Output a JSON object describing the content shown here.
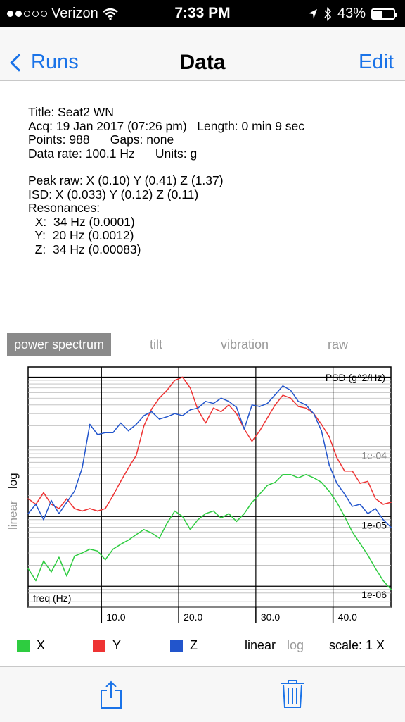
{
  "status": {
    "carrier": "Verizon",
    "time": "7:33 PM",
    "battery": "43%",
    "signal_bars": 2
  },
  "nav": {
    "back_label": "Runs",
    "title": "Data",
    "edit_label": "Edit"
  },
  "info": {
    "title": "Title: Seat2 WN",
    "acq": "Acq: 19 Jan 2017 (07:26 pm)   Length: 0 min 9 sec",
    "points": "Points: 988      Gaps: none",
    "rate": "Data rate: 100.1 Hz      Units: g",
    "peak": "Peak raw: X (0.10) Y (0.41) Z (1.37)",
    "isd": "ISD: X (0.033) Y (0.12) Z (0.11)",
    "res": "Resonances:",
    "rx": "  X:  34 Hz (0.0001)",
    "ry": "  Y:  20 Hz (0.0012)",
    "rz": "  Z:  34 Hz (0.00083)"
  },
  "tabs": [
    "power spectrum",
    "tilt",
    "vibration",
    "raw"
  ],
  "side_labels": {
    "linear": "linear",
    "log": "log"
  },
  "chart_data": {
    "type": "line",
    "title": "PSD (g^2/Hz)",
    "xlabel": "freq (Hz)",
    "x_ticks": [
      "10.0",
      "20.0",
      "30.0",
      "40.0"
    ],
    "y_ticks": [
      "1e-04",
      "1e-05",
      "1e-06"
    ],
    "yscale": "log",
    "ylim": [
      5e-07,
      0.0014
    ],
    "xlim": [
      0.5,
      47.5
    ],
    "grid": true,
    "series": [
      {
        "name": "X",
        "color": "#2ecc40",
        "x": [
          0.5,
          1.5,
          2.5,
          3.5,
          4.5,
          5.5,
          6.5,
          7.5,
          8.5,
          9.5,
          10.5,
          11.5,
          12.5,
          13.5,
          14.5,
          15.5,
          16.5,
          17.5,
          18.5,
          19.5,
          20.5,
          21.5,
          22.5,
          23.5,
          24.5,
          25.5,
          26.5,
          27.5,
          28.5,
          29.5,
          30.5,
          31.5,
          32.5,
          33.5,
          34.5,
          35.5,
          36.5,
          37.5,
          38.5,
          39.5,
          40.5,
          41.5,
          42.5,
          43.5,
          44.5,
          45.5,
          46.5,
          47.5
        ],
        "y": [
          1.8e-06,
          1.2e-06,
          2.3e-06,
          1.6e-06,
          2.6e-06,
          1.4e-06,
          2.7e-06,
          3e-06,
          3.4e-06,
          3.2e-06,
          2.4e-06,
          3.4e-06,
          4e-06,
          4.6e-06,
          5.5e-06,
          6.5e-06,
          5.8e-06,
          4.9e-06,
          8e-06,
          1.2e-05,
          1e-05,
          6.5e-06,
          9e-06,
          1.1e-05,
          1.2e-05,
          9.5e-06,
          1.1e-05,
          8.5e-06,
          1.1e-05,
          1.6e-05,
          2.1e-05,
          2.8e-05,
          3.1e-05,
          4e-05,
          4e-05,
          3.6e-05,
          4e-05,
          3.6e-05,
          3.1e-05,
          2.3e-05,
          1.6e-05,
          1e-05,
          6e-06,
          4.1e-06,
          2.8e-06,
          1.8e-06,
          1.2e-06,
          9e-07
        ]
      },
      {
        "name": "Y",
        "color": "#ee3333",
        "x": [
          0.5,
          1.5,
          2.5,
          3.5,
          4.5,
          5.5,
          6.5,
          7.5,
          8.5,
          9.5,
          10.5,
          11.5,
          12.5,
          13.5,
          14.5,
          15.5,
          16.5,
          17.5,
          18.5,
          19.5,
          20.5,
          21.5,
          22.5,
          23.5,
          24.5,
          25.5,
          26.5,
          27.5,
          28.5,
          29.5,
          30.5,
          31.5,
          32.5,
          33.5,
          34.5,
          35.5,
          36.5,
          37.5,
          38.5,
          39.5,
          40.5,
          41.5,
          42.5,
          43.5,
          44.5,
          45.5,
          46.5,
          47.5
        ],
        "y": [
          1.8e-05,
          1.5e-05,
          2.2e-05,
          1.5e-05,
          1.3e-05,
          1.8e-05,
          1.3e-05,
          1.2e-05,
          1.3e-05,
          1.2e-05,
          1.3e-05,
          2e-05,
          3.2e-05,
          5e-05,
          7.5e-05,
          0.0002,
          0.00035,
          0.0005,
          0.00065,
          0.0009,
          0.001,
          0.0007,
          0.00034,
          0.00022,
          0.00036,
          0.00032,
          0.0004,
          0.0003,
          0.00018,
          0.00012,
          0.00017,
          0.00026,
          0.0004,
          0.00055,
          0.0005,
          0.00038,
          0.00036,
          0.0003,
          0.00021,
          0.00014,
          7e-05,
          4.5e-05,
          4.5e-05,
          3e-05,
          3.2e-05,
          1.8e-05,
          1.5e-05,
          1.6e-05
        ]
      },
      {
        "name": "Z",
        "color": "#2255cc",
        "x": [
          0.5,
          1.5,
          2.5,
          3.5,
          4.5,
          5.5,
          6.5,
          7.5,
          8.5,
          9.5,
          10.5,
          11.5,
          12.5,
          13.5,
          14.5,
          15.5,
          16.5,
          17.5,
          18.5,
          19.5,
          20.5,
          21.5,
          22.5,
          23.5,
          24.5,
          25.5,
          26.5,
          27.5,
          28.5,
          29.5,
          30.5,
          31.5,
          32.5,
          33.5,
          34.5,
          35.5,
          36.5,
          37.5,
          38.5,
          39.5,
          40.5,
          41.5,
          42.5,
          43.5,
          44.5,
          45.5,
          46.5,
          47.5
        ],
        "y": [
          1.1e-05,
          1.5e-05,
          9e-06,
          1.7e-05,
          1.1e-05,
          1.6e-05,
          2.3e-05,
          5e-05,
          0.00021,
          0.00015,
          0.00016,
          0.00016,
          0.00022,
          0.00017,
          0.00021,
          0.00028,
          0.00032,
          0.00025,
          0.00027,
          0.0003,
          0.00028,
          0.00034,
          0.00036,
          0.00045,
          0.00042,
          0.0005,
          0.00045,
          0.00037,
          0.00018,
          0.0004,
          0.00038,
          0.00042,
          0.00056,
          0.00075,
          0.00065,
          0.00045,
          0.0004,
          0.0003,
          0.00017,
          5.5e-05,
          3e-05,
          2.1e-05,
          1.4e-05,
          1.5e-05,
          1.1e-05,
          1.3e-05,
          9e-06,
          7e-06
        ]
      }
    ]
  },
  "legend": {
    "x": "X",
    "y": "Y",
    "z": "Z",
    "x_color": "#2ecc40",
    "y_color": "#ee3333",
    "z_color": "#2255cc",
    "linear": "linear",
    "log": "log",
    "scale": "scale: 1 X"
  }
}
